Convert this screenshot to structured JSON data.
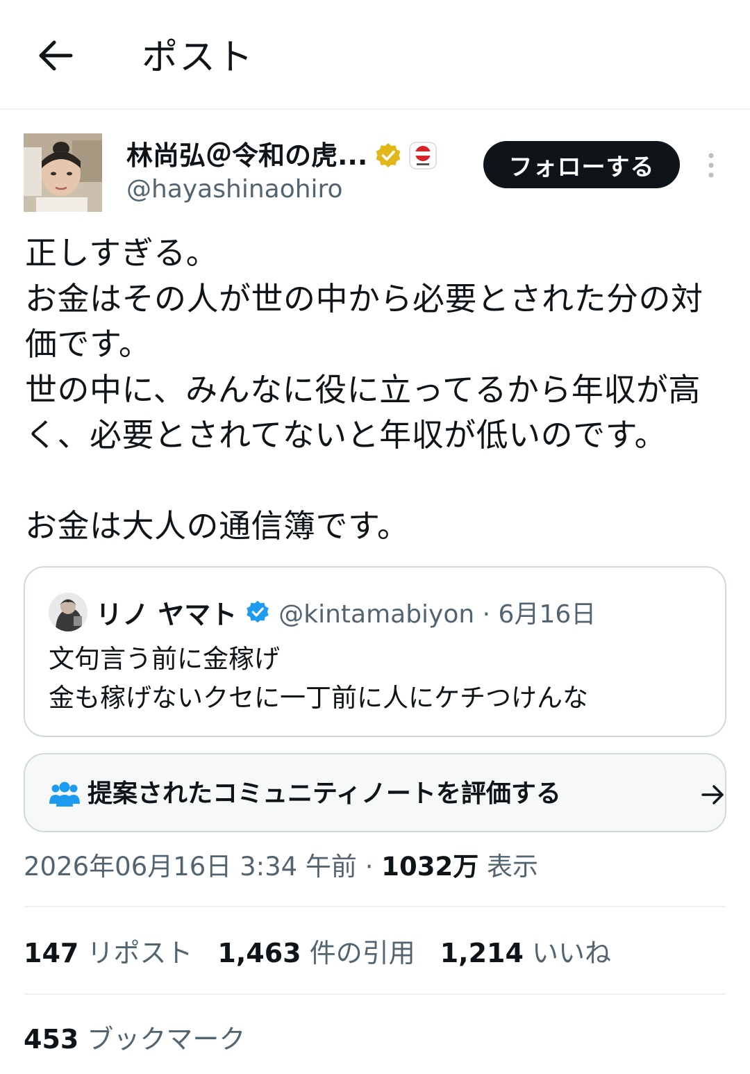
{
  "topbar": {
    "back_icon": "arrow-left-icon",
    "title": "ポスト"
  },
  "author": {
    "name": "林尚弘＠令和の虎...",
    "handle": "@hayashinaohiro",
    "verified_badge_color": "#e2b719",
    "affiliate_badge": "令和の虎 badge",
    "follow_label": "フォローする",
    "more_icon": "more-vertical-icon"
  },
  "tweet": {
    "text": "正しすぎる。\nお金はその人が世の中から必要とされた分の対価です。\n世の中に、みんなに役に立ってるから年収が高く、必要とされてないと年収が低いのです。\n\nお金は大人の通信簿です。"
  },
  "quote": {
    "name": "リノ ヤマト",
    "verified_badge_color": "#1d9bf0",
    "meta": "@kintamabiyon · 6月16日",
    "text": "文句言う前に金稼げ\n金も稼げないクセに一丁前に人にケチつけんな"
  },
  "community_note": {
    "icon": "people-icon",
    "label": "提案されたコミュニティノートを評価する",
    "arrow_icon": "arrow-right-icon",
    "icon_color": "#1d9bf0"
  },
  "meta": {
    "timestamp": "2026年06月16日 3:34 午前 · ",
    "views_count": "1032万",
    "views_label": " 表示"
  },
  "stats": {
    "reposts_count": "147",
    "reposts_label": " リポスト",
    "quotes_count": "1,463",
    "quotes_label": " 件の引用",
    "likes_count": "1,214",
    "likes_label": " いいね",
    "bookmarks_count": "453",
    "bookmarks_label": " ブックマーク"
  }
}
